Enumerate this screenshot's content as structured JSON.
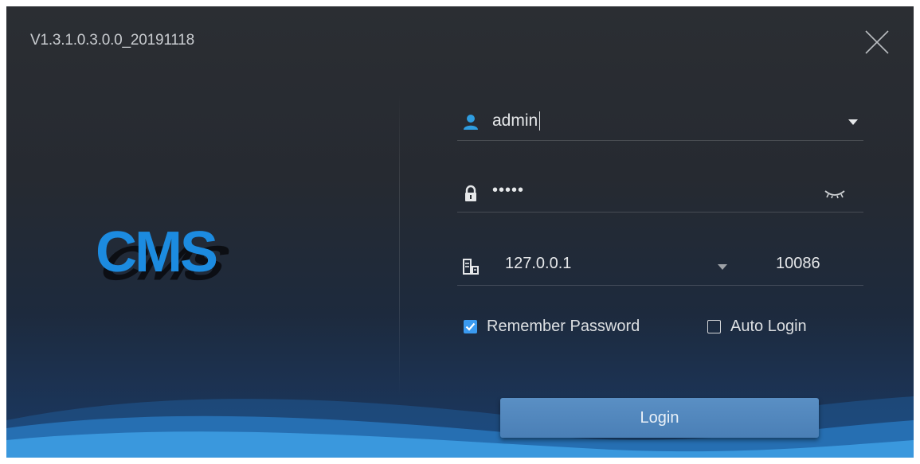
{
  "window": {
    "version": "V1.3.1.0.3.0.0_20191118"
  },
  "logo": {
    "text": "CMS",
    "color": "#1c8be0"
  },
  "form": {
    "username": {
      "value": "admin",
      "icon": "user-icon"
    },
    "password": {
      "masked_value": "•••••",
      "icon": "lock-icon",
      "toggle_icon": "eye-closed-icon"
    },
    "server": {
      "address": "127.0.0.1",
      "port": "10086",
      "icon": "server-icon"
    },
    "remember_password": {
      "label": "Remember Password",
      "checked": true
    },
    "auto_login": {
      "label": "Auto Login",
      "checked": false
    },
    "login_button": {
      "label": "Login"
    }
  },
  "colors": {
    "accent": "#3a9af0",
    "user_icon": "#2f9de0",
    "button": "#4f86bd"
  }
}
